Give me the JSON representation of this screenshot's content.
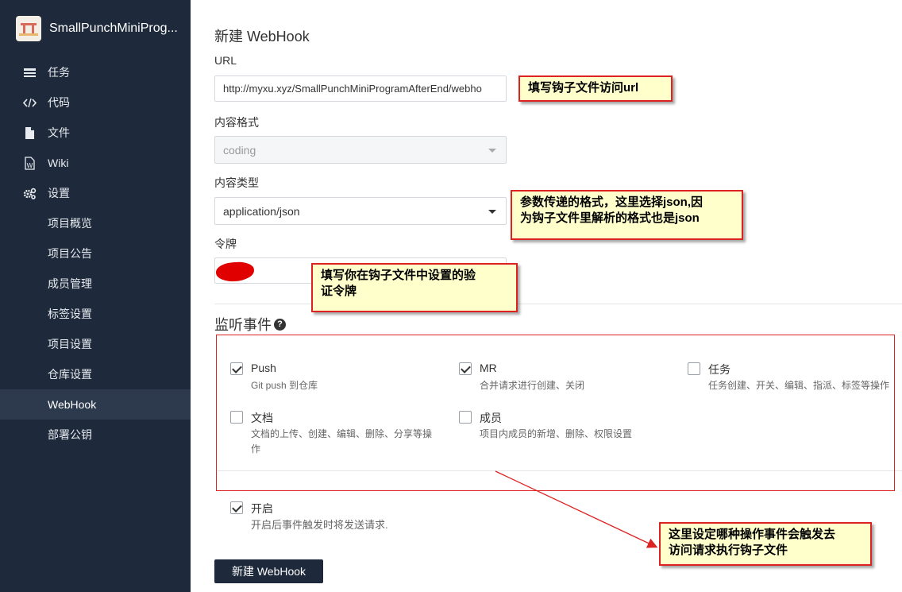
{
  "sidebar": {
    "project_name": "SmallPunchMiniProg...",
    "items": [
      {
        "label": "任务",
        "icon": "task-icon"
      },
      {
        "label": "代码",
        "icon": "code-icon"
      },
      {
        "label": "文件",
        "icon": "file-icon"
      },
      {
        "label": "Wiki",
        "icon": "wiki-icon"
      },
      {
        "label": "设置",
        "icon": "gear-icon"
      }
    ],
    "settings_items": [
      "项目概览",
      "项目公告",
      "成员管理",
      "标签设置",
      "项目设置",
      "仓库设置",
      "WebHook",
      "部署公钥"
    ],
    "active_item": "WebHook"
  },
  "form": {
    "title": "新建 WebHook",
    "url_label": "URL",
    "url_value": "http://myxu.xyz/SmallPunchMiniProgramAfterEnd/webho",
    "format_label": "内容格式",
    "format_value": "coding",
    "type_label": "内容类型",
    "type_value": "application/json",
    "token_label": "令牌"
  },
  "events": {
    "title": "监听事件",
    "items": [
      {
        "title": "Push",
        "desc": "Git push 到仓库",
        "checked": true
      },
      {
        "title": "MR",
        "desc": "合并请求进行创建、关闭",
        "checked": true
      },
      {
        "title": "任务",
        "desc": "任务创建、开关、编辑、指派、标签等操作",
        "checked": false
      },
      {
        "title": "文档",
        "desc": "文档的上传、创建、编辑、删除、分享等操作",
        "checked": false
      },
      {
        "title": "成员",
        "desc": "项目内成员的新增、删除、权限设置",
        "checked": false
      }
    ]
  },
  "enable": {
    "title": "开启",
    "desc": "开启后事件触发时将发送请求.",
    "checked": true
  },
  "submit_label": "新建 WebHook",
  "annotations": {
    "url_note": "填写钩子文件访问url",
    "type_note_line1": "参数传递的格式，这里选择json,因",
    "type_note_line2": "为钩子文件里解析的格式也是json",
    "token_note_line1": "填写你在钩子文件中设置的验",
    "token_note_line2": "证令牌",
    "events_note_line1": "这里设定哪种操作事件会触发去",
    "events_note_line2": "访问请求执行钩子文件"
  },
  "colors": {
    "sidebar_bg": "#1e2a3b",
    "sidebar_active": "#2d3a4d",
    "annotation_border": "#dd2222",
    "annotation_bg": "#ffffcc"
  }
}
